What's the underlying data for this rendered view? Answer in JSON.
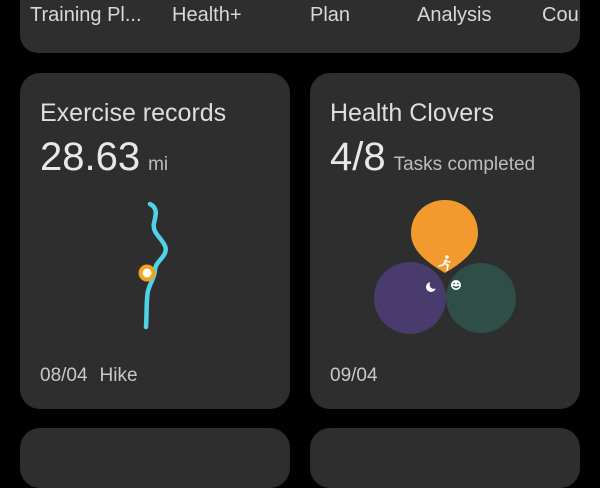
{
  "tabs": [
    {
      "label": "Training Pl..."
    },
    {
      "label": "Health+"
    },
    {
      "label": "Plan"
    },
    {
      "label": "Analysis"
    },
    {
      "label": "Cou"
    }
  ],
  "exercise_card": {
    "title": "Exercise records",
    "value": "28.63",
    "unit": "mi",
    "date": "08/04",
    "activity": "Hike",
    "route_color": "#4fd3e6",
    "marker_color": "#f3a21c"
  },
  "clovers_card": {
    "title": "Health Clovers",
    "completed": "4/8",
    "completed_label": "Tasks completed",
    "date": "09/04",
    "petals": [
      {
        "name": "activity",
        "icon": "running-icon",
        "color": "#f29a2e"
      },
      {
        "name": "sleep",
        "icon": "moon-icon",
        "color": "#4a3b6e"
      },
      {
        "name": "mood",
        "icon": "smile-icon",
        "color": "#2f4e48"
      }
    ]
  }
}
